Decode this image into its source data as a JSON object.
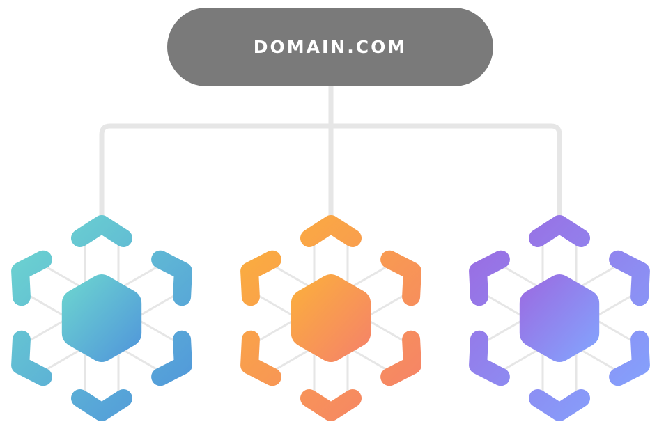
{
  "root": {
    "label": "DOMAIN.COM",
    "color": "#7a7a7a"
  },
  "connector_color": "#e6e6e6",
  "clusters": [
    {
      "name": "teal-cluster",
      "gradient": [
        "#6ed8cf",
        "#4f93db"
      ]
    },
    {
      "name": "orange-cluster",
      "gradient": [
        "#fbb13b",
        "#f5806b"
      ]
    },
    {
      "name": "purple-cluster",
      "gradient": [
        "#9c68e0",
        "#82a7ff"
      ]
    }
  ]
}
